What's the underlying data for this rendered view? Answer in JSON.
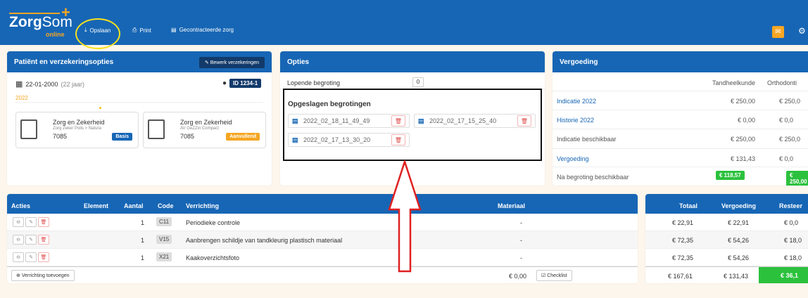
{
  "topbar": {
    "brand_main": "Zorg",
    "brand_sub": "Som",
    "brand_tag": "online",
    "save": "Opslaan",
    "print": "Print",
    "contracted": "Gecontracteerde zorg"
  },
  "patient": {
    "title": "Patiënt en verzekeringsopties",
    "edit_btn": "Bewerk verzekeringen",
    "dob": "22-01-2000",
    "age": "(22 jaar)",
    "id": "ID 1234-1",
    "year": "2022",
    "cards": [
      {
        "name": "Zorg en Zekerheid",
        "policy": "Zorg Zeker Polis > Natura",
        "code": "7085",
        "badge": "Basis"
      },
      {
        "name": "Zorg en Zekerheid",
        "policy": "AV GeZZin Compact",
        "code": "7085",
        "badge": "Aanvullend"
      }
    ]
  },
  "opties": {
    "title": "Opties",
    "running_label": "Lopende begroting",
    "running_value": "0",
    "saved_title": "Opgeslagen begrotingen",
    "saved": [
      "2022_02_18_11_49_49",
      "2022_02_17_15_25_40",
      "2022_02_17_13_30_20"
    ]
  },
  "vergoeding": {
    "title": "Vergoeding",
    "col1": "Tandheelkunde",
    "col2": "Orthodonti",
    "rows": [
      {
        "label": "Indicatie 2022",
        "v1": "€ 250,00",
        "v2": "€ 250,0",
        "link": true
      },
      {
        "label": "Historie 2022",
        "v1": "€ 0,00",
        "v2": "€ 0,0",
        "link": true
      },
      {
        "label": "Indicatie beschikbaar",
        "v1": "€ 250,00",
        "v2": "€ 250,0",
        "link": false
      },
      {
        "label": "Vergoeding",
        "v1": "€ 131,43",
        "v2": "€ 0,0",
        "link": true
      }
    ],
    "avail_label": "Na begroting beschikbaar",
    "avail1": "€ 118,57",
    "avail2": "€ 250,00"
  },
  "table": {
    "h_acties": "Acties",
    "h_element": "Element",
    "h_aantal": "Aantal",
    "h_code": "Code",
    "h_verrichting": "Verrichting",
    "h_materiaal": "Materiaal",
    "rows": [
      {
        "aantal": "1",
        "code": "C11",
        "verrichting": "Periodieke controle",
        "materiaal": "-"
      },
      {
        "aantal": "1",
        "code": "V15",
        "verrichting": "Aanbrengen schildje van tandkleurig plastisch materiaal",
        "materiaal": "-"
      },
      {
        "aantal": "1",
        "code": "X21",
        "verrichting": "Kaakoverzichtsfoto",
        "materiaal": "-"
      }
    ],
    "add_btn": "Verrichting toevoegen",
    "material_total": "€ 0,00",
    "checklist": "Checklist"
  },
  "totals": {
    "h_totaal": "Totaal",
    "h_vergoeding": "Vergoeding",
    "h_resteer": "Resteer",
    "rows": [
      {
        "t": "€ 22,91",
        "v": "€ 22,91",
        "r": "€ 0,0"
      },
      {
        "t": "€ 72,35",
        "v": "€ 54,26",
        "r": "€ 18,0"
      },
      {
        "t": "€ 72,35",
        "v": "€ 54,26",
        "r": "€ 18,0"
      }
    ],
    "sum_t": "€ 167,61",
    "sum_v": "€ 131,43",
    "sum_r": "€ 36,1"
  },
  "colors": {
    "primary": "#1766b5",
    "accent": "#f5a623",
    "green": "#2cc13d",
    "annotation": "#e02020"
  }
}
